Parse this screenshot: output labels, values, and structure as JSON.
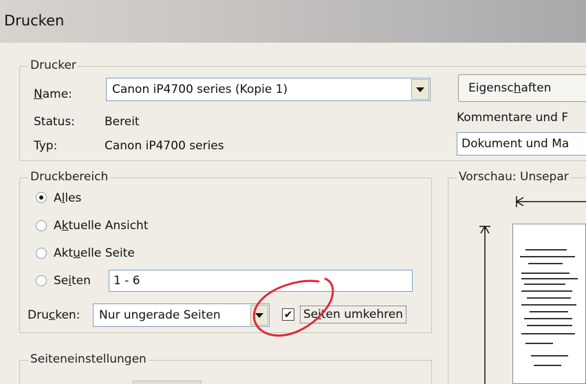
{
  "window": {
    "title": "Drucken"
  },
  "printer": {
    "group_label": "Drucker",
    "name_label_prefix": "N",
    "name_label_rest": "ame:",
    "name_value": "Canon iP4700 series (Kopie 1)",
    "status_label": "Status:",
    "status_value": "Bereit",
    "type_label": "Typ:",
    "type_value": "Canon iP4700 series",
    "properties_pre": "Eigensc",
    "properties_u": "h",
    "properties_post": "aften",
    "comments_label": "Kommentare und F",
    "comments_value": "Dokument und Ma"
  },
  "range": {
    "group_label": "Druckbereich",
    "all_pre": "A",
    "all_u": "l",
    "all_post": "les",
    "current_view_pre": "A",
    "current_view_u": "k",
    "current_view_post": "tuelle Ansicht",
    "current_page_pre": "Akt",
    "current_page_u": "u",
    "current_page_post": "elle Seite",
    "pages_pre": "Se",
    "pages_u": "i",
    "pages_post": "ten",
    "pages_value": "1 - 6",
    "print_label_pre": "Dru",
    "print_label_u": "c",
    "print_label_post": "ken:",
    "print_value": "Nur ungerade Seiten",
    "reverse_pre": "Se",
    "reverse_u": "i",
    "reverse_post": "ten umkehren",
    "reverse_checked": true,
    "selected_option": "Alles"
  },
  "page_setup": {
    "group_label": "Seiteneinstellungen"
  },
  "preview": {
    "label": "Vorschau: Unsepar"
  },
  "annotation": {
    "circle_color": "#e0283a"
  }
}
